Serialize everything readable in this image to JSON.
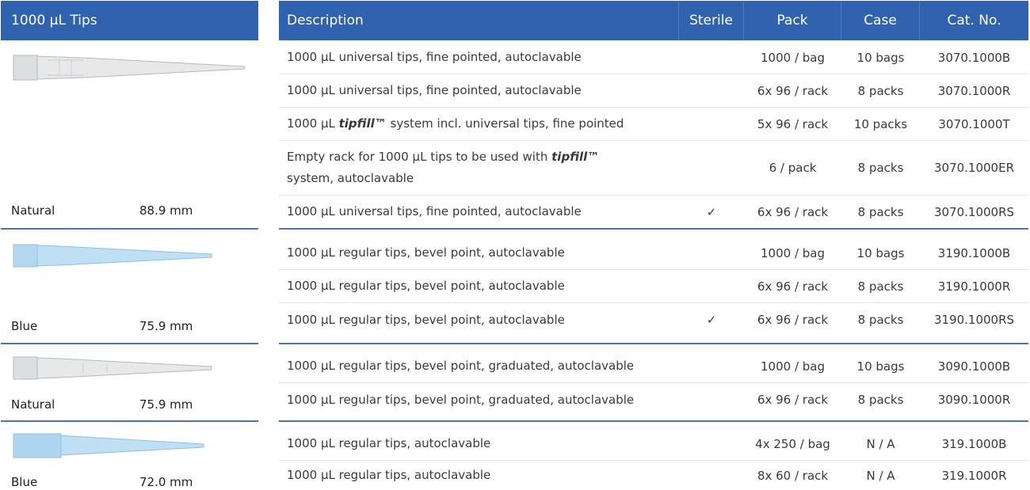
{
  "left_header": "1000 µL Tips",
  "columns": [
    "Description",
    "Sterile",
    "Pack",
    "Case",
    "Cat. No."
  ],
  "variants": [
    {
      "color": "Natural",
      "length": "88.9 mm",
      "tip_color": "natural"
    },
    {
      "color": "Blue",
      "length": "75.9 mm",
      "tip_color": "blue"
    },
    {
      "color": "Natural",
      "length": "75.9 mm",
      "tip_color": "natural"
    },
    {
      "color": "Blue",
      "length": "72.0 mm",
      "tip_color": "blue"
    }
  ],
  "rows": [
    {
      "desc": "1000 µL universal tips, fine pointed, autoclavable",
      "sterile": "",
      "pack": "1000 / bag",
      "case": "10 bags",
      "cat": "3070.1000B"
    },
    {
      "desc": "1000 µL universal tips, fine pointed, autoclavable",
      "sterile": "",
      "pack": "6x 96 / rack",
      "case": "8 packs",
      "cat": "3070.1000R"
    },
    {
      "desc_pre": "1000 µL ",
      "desc_brand": "tipfill",
      "desc_tm": "™",
      "desc_post": " system incl. universal tips, fine pointed",
      "sterile": "",
      "pack": "5x 96 / rack",
      "case": "10 packs",
      "cat": "3070.1000T"
    },
    {
      "desc_pre": "Empty rack for 1000 µL tips to be used with ",
      "desc_brand": "tipfill",
      "desc_tm": "™",
      "desc_post": " system, autoclavable",
      "sterile": "",
      "pack": "6 / pack",
      "case": "8 packs",
      "cat": "3070.1000ER"
    },
    {
      "desc": "1000 µL universal tips, fine pointed, autoclavable",
      "sterile": "✓",
      "pack": "6x 96 / rack",
      "case": "8 packs",
      "cat": "3070.1000RS"
    },
    {
      "desc": "1000 µL regular tips, bevel point, autoclavable",
      "sterile": "",
      "pack": "1000 / bag",
      "case": "10 bags",
      "cat": "3190.1000B"
    },
    {
      "desc": "1000 µL regular tips, bevel point, autoclavable",
      "sterile": "",
      "pack": "6x 96 / rack",
      "case": "8 packs",
      "cat": "3190.1000R"
    },
    {
      "desc": "1000 µL regular tips, bevel point, autoclavable",
      "sterile": "✓",
      "pack": "6x 96 / rack",
      "case": "8 packs",
      "cat": "3190.1000RS"
    },
    {
      "desc": "1000 µL regular tips, bevel point, graduated, autoclavable",
      "sterile": "",
      "pack": "1000 / bag",
      "case": "10 bags",
      "cat": "3090.1000B"
    },
    {
      "desc": "1000 µL regular tips, bevel point, graduated, autoclavable",
      "sterile": "",
      "pack": "6x 96 / rack",
      "case": "8 packs",
      "cat": "3090.1000R"
    },
    {
      "desc": "1000 µL regular tips, autoclavable",
      "sterile": "",
      "pack": "4x 250 / bag",
      "case": "N / A",
      "cat": "319.1000B"
    },
    {
      "desc": "1000 µL regular tips, autoclavable",
      "sterile": "",
      "pack": "8x 60 / rack",
      "case": "N / A",
      "cat": "319.1000R"
    }
  ],
  "colors": {
    "header_bg": "#2f63b0",
    "separator": "#4e74ad",
    "tip_natural": "#e6e8ea",
    "tip_blue": "#bfe0f4"
  }
}
